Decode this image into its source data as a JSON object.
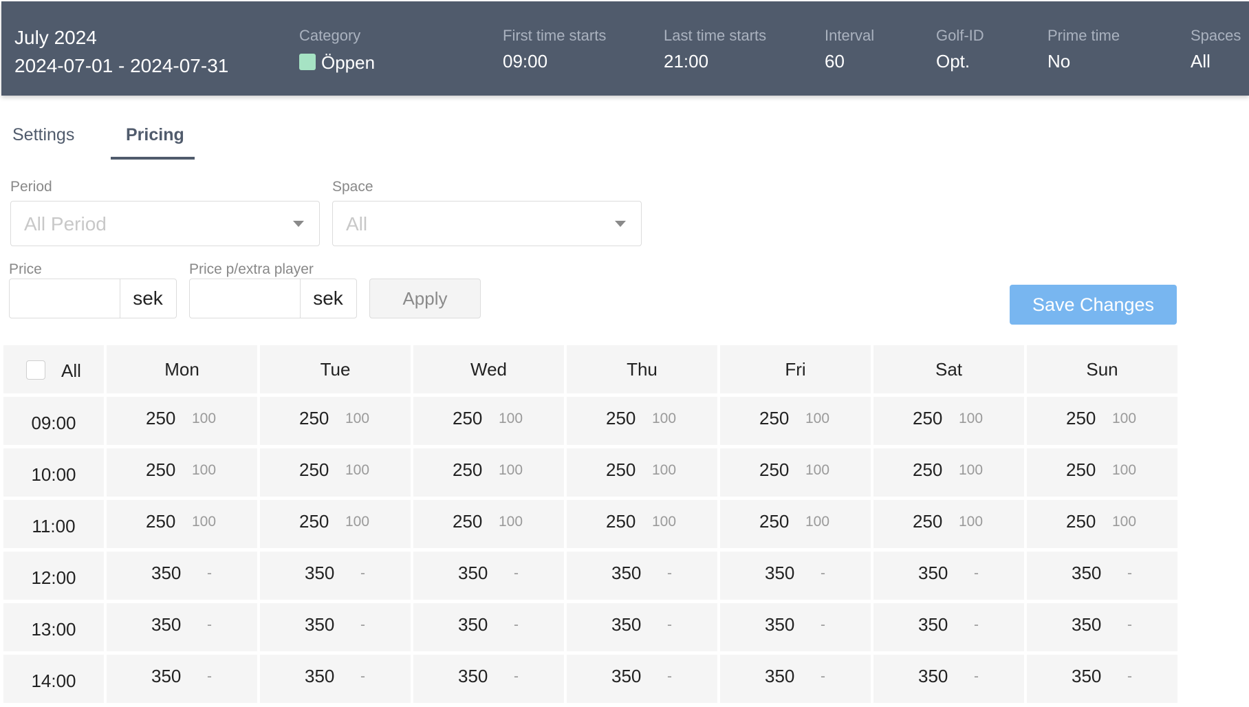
{
  "header": {
    "title": "July 2024",
    "date_range": "2024-07-01 - 2024-07-31",
    "category_label": "Category",
    "category_value": "Öppen",
    "category_color": "#a6e3c4",
    "first_time_label": "First time starts",
    "first_time_value": "09:00",
    "last_time_label": "Last time starts",
    "last_time_value": "21:00",
    "interval_label": "Interval",
    "interval_value": "60",
    "golfid_label": "Golf-ID",
    "golfid_value": "Opt.",
    "prime_label": "Prime time",
    "prime_value": "No",
    "spaces_label": "Spaces",
    "spaces_value": "All"
  },
  "tabs": [
    {
      "label": "Settings",
      "active": false
    },
    {
      "label": "Pricing",
      "active": true
    }
  ],
  "form": {
    "period_label": "Period",
    "period_placeholder": "All Period",
    "space_label": "Space",
    "space_placeholder": "All",
    "price_label": "Price",
    "price_value": "",
    "price_unit": "sek",
    "extra_label": "Price p/extra player",
    "extra_value": "",
    "extra_unit": "sek",
    "apply_label": "Apply",
    "save_label": "Save Changes"
  },
  "grid": {
    "all_label": "All",
    "days": [
      "Mon",
      "Tue",
      "Wed",
      "Thu",
      "Fri",
      "Sat",
      "Sun"
    ],
    "rows": [
      {
        "time": "09:00",
        "price": "250",
        "extra": "100"
      },
      {
        "time": "10:00",
        "price": "250",
        "extra": "100"
      },
      {
        "time": "11:00",
        "price": "250",
        "extra": "100"
      },
      {
        "time": "12:00",
        "price": "350",
        "extra": "-"
      },
      {
        "time": "13:00",
        "price": "350",
        "extra": "-"
      },
      {
        "time": "14:00",
        "price": "350",
        "extra": "-"
      }
    ]
  },
  "colors": {
    "header_bg": "#505b6c",
    "accent_button": "#78b6f0"
  }
}
